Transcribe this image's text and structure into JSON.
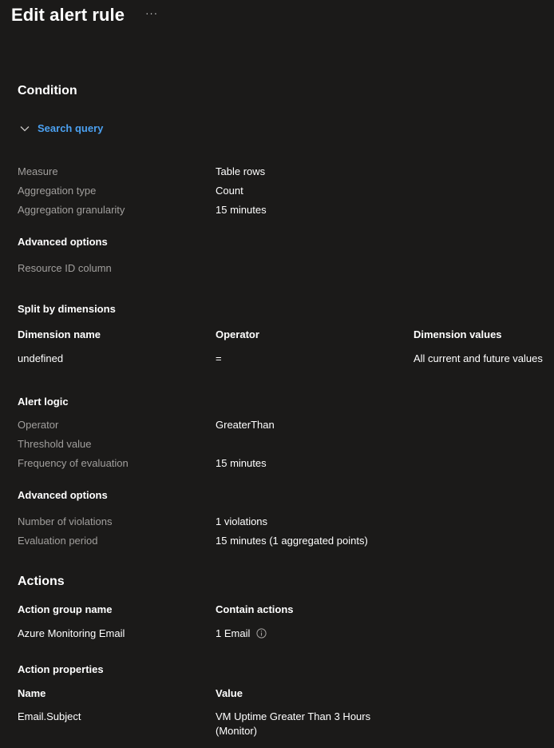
{
  "header": {
    "title": "Edit alert rule",
    "more_label": "···"
  },
  "condition": {
    "title": "Condition",
    "search_query_label": "Search query",
    "measure_label": "Measure",
    "measure_value": "Table rows",
    "aggregation_type_label": "Aggregation type",
    "aggregation_type_value": "Count",
    "aggregation_granularity_label": "Aggregation granularity",
    "aggregation_granularity_value": "15 minutes",
    "advanced_options_title": "Advanced options",
    "resource_id_label": "Resource ID column",
    "split_title": "Split by dimensions",
    "split_headers": [
      "Dimension name",
      "Operator",
      "Dimension values"
    ],
    "split_rows": [
      [
        "undefined",
        "=",
        "All current and future values"
      ]
    ],
    "alert_logic_title": "Alert logic",
    "operator_label": "Operator",
    "operator_value": "GreaterThan",
    "threshold_label": "Threshold value",
    "frequency_label": "Frequency of evaluation",
    "frequency_value": "15 minutes",
    "advanced_options2_title": "Advanced options",
    "violations_label": "Number of violations",
    "violations_value": "1 violations",
    "evaluation_period_label": "Evaluation period",
    "evaluation_period_value": "15 minutes (1 aggregated points)"
  },
  "actions": {
    "title": "Actions",
    "group_headers": [
      "Action group name",
      "Contain actions"
    ],
    "group_name": "Azure Monitoring Email",
    "group_actions": "1 Email",
    "properties_title": "Action properties",
    "property_headers": [
      "Name",
      "Value"
    ],
    "property_name": "Email.Subject",
    "property_value_line1": "VM Uptime Greater Than 3 Hours",
    "property_value_line2": "(Monitor)"
  },
  "colors": {
    "background": "#1b1a19",
    "link": "#4ba0f0",
    "label": "#a19f9d"
  }
}
